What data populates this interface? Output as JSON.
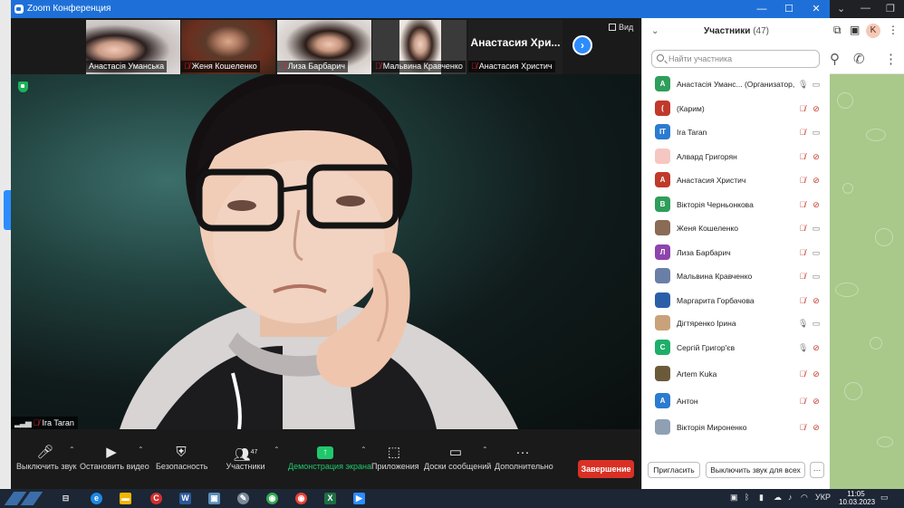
{
  "window": {
    "title": "Zoom Конференция",
    "min": "—",
    "max": "☐",
    "close": "✕"
  },
  "browser_right": {
    "avatar_letter": "K",
    "brand_colors": {
      "chat_bg": "#a8c98a"
    }
  },
  "thumbnails": [
    {
      "name": "Анастасія Уманська",
      "muted": false
    },
    {
      "name": "Женя Кошеленко",
      "muted": true
    },
    {
      "name": "Лиза Барбарич",
      "muted": true
    },
    {
      "name": "Мальвина Кравченко",
      "muted": true
    },
    {
      "name": "Анастасия Христич",
      "muted": true,
      "big_name": "Анастасия Хри..."
    }
  ],
  "view_label": "Вид",
  "speaker": {
    "name": "Ira Taran",
    "muted": true
  },
  "controls": {
    "mute": "Выключить звук",
    "video": "Остановить видео",
    "security": "Безопасность",
    "participants": "Участники",
    "participants_count": "47",
    "share": "Демонстрация экрана",
    "apps": "Приложения",
    "whiteboards": "Доски сообщений",
    "more": "Дополнительно",
    "end": "Завершение"
  },
  "panel": {
    "title": "Участники",
    "count": "(47)",
    "search_placeholder": "Найти участника",
    "invite": "Пригласить",
    "mute_all": "Выключить звук для всех",
    "more": "···",
    "participants": [
      {
        "initial": "А",
        "color": "#2e9e5a",
        "name": "Анастасія Уманс... (Организатор, я)",
        "mic": "on",
        "cam": "on"
      },
      {
        "initial": "(",
        "color": "#c0392b",
        "name": "(Карим)",
        "mic": "off",
        "cam": "off"
      },
      {
        "initial": "IT",
        "color": "#2b7bd0",
        "name": "Ira Taran",
        "mic": "off",
        "cam": "on"
      },
      {
        "initial": "",
        "color": "#f6c7c0",
        "name": "Алвард Григорян",
        "mic": "off",
        "cam": "off"
      },
      {
        "initial": "А",
        "color": "#c0392b",
        "name": "Анастасия Христич",
        "mic": "off",
        "cam": "off"
      },
      {
        "initial": "В",
        "color": "#2e9e5a",
        "name": "Вікторія Черньонкова",
        "mic": "off",
        "cam": "off"
      },
      {
        "initial": "",
        "color": "#8a6b55",
        "name": "Женя Кошеленко",
        "mic": "off",
        "cam": "on"
      },
      {
        "initial": "Л",
        "color": "#8e44ad",
        "name": "Лиза Барбарич",
        "mic": "off",
        "cam": "on"
      },
      {
        "initial": "",
        "color": "#6a7fa8",
        "name": "Мальвина Кравченко",
        "mic": "off",
        "cam": "on"
      },
      {
        "initial": "",
        "color": "#2a5fa8",
        "name": "Маргарита Горбачова",
        "mic": "off",
        "cam": "off"
      },
      {
        "initial": "",
        "color": "#c9a27a",
        "name": "Дігтяренко Ірина",
        "mic": "on",
        "cam": "on"
      },
      {
        "initial": "С",
        "color": "#1fae6a",
        "name": "Сергій Григор'єв",
        "mic": "on",
        "cam": "off"
      },
      {
        "initial": "",
        "color": "#6b5a3a",
        "name": "Artem Kuka",
        "mic": "off",
        "cam": "off"
      },
      {
        "initial": "А",
        "color": "#2b7bd0",
        "name": "Антон",
        "mic": "off",
        "cam": "off"
      },
      {
        "initial": "",
        "color": "#8fa0b3",
        "name": "Вікторія Мироненко",
        "mic": "off",
        "cam": "off"
      }
    ]
  },
  "taskbar": {
    "lang": "УКР",
    "time": "11:05",
    "date": "10.03.2023"
  }
}
